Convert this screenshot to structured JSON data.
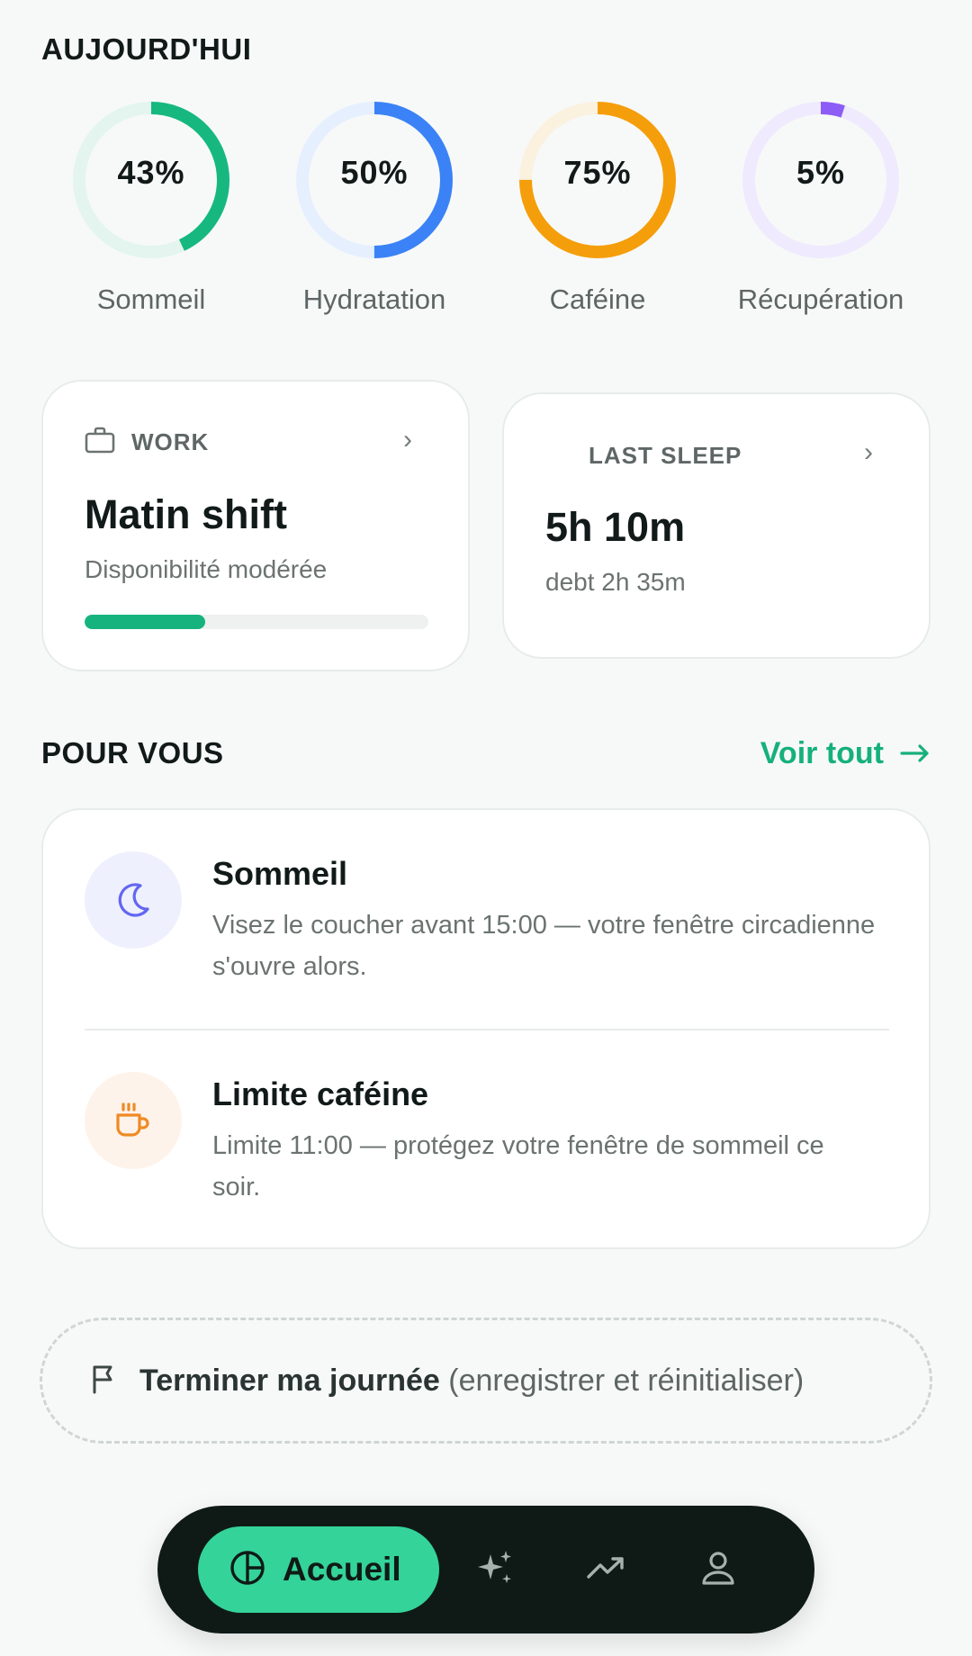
{
  "today": {
    "title": "AUJOURD'HUI",
    "rings": [
      {
        "label": "Sommeil",
        "percent_text": "43%",
        "value": 43,
        "color": "#16b880",
        "track": "#e3f5ee"
      },
      {
        "label": "Hydratation",
        "percent_text": "50%",
        "value": 50,
        "color": "#3b82f6",
        "track": "#e6effd"
      },
      {
        "label": "Caféine",
        "percent_text": "75%",
        "value": 75,
        "color": "#f59e0b",
        "track": "#fbf1df"
      },
      {
        "label": "Récupération",
        "percent_text": "5%",
        "value": 5,
        "color": "#8b5cf6",
        "track": "#efeafd"
      }
    ]
  },
  "work_card": {
    "kicker": "WORK",
    "title": "Matin shift",
    "subtitle": "Disponibilité modérée",
    "progress": 0.35,
    "icon": "briefcase-icon"
  },
  "sleep_card": {
    "kicker": "LAST SLEEP",
    "title": "5h 10m",
    "subtitle": "debt 2h 35m",
    "icon": "moon-icon"
  },
  "for_you": {
    "title": "POUR VOUS",
    "see_all": "Voir tout",
    "tips": [
      {
        "title": "Sommeil",
        "body": "Visez le coucher avant 15:00 — votre fenêtre circadienne s'ouvre alors.",
        "icon": "moon-icon",
        "icon_color": "#6366f1",
        "icon_bg": "#eef0fe"
      },
      {
        "title": "Limite caféine",
        "body": "Limite 11:00 — protégez votre fenêtre de sommeil ce soir.",
        "icon": "coffee-icon",
        "icon_color": "#f08a24",
        "icon_bg": "#fdf3ea"
      }
    ]
  },
  "end_day": {
    "strong": "Terminer ma journée",
    "muted": "(enregistrer et réinitialiser)",
    "icon": "flag-icon"
  },
  "nav": {
    "active_label": "Accueil",
    "items": [
      "home-icon",
      "sparkles-icon",
      "trending-icon",
      "profile-icon"
    ],
    "accent": "#34d399"
  }
}
